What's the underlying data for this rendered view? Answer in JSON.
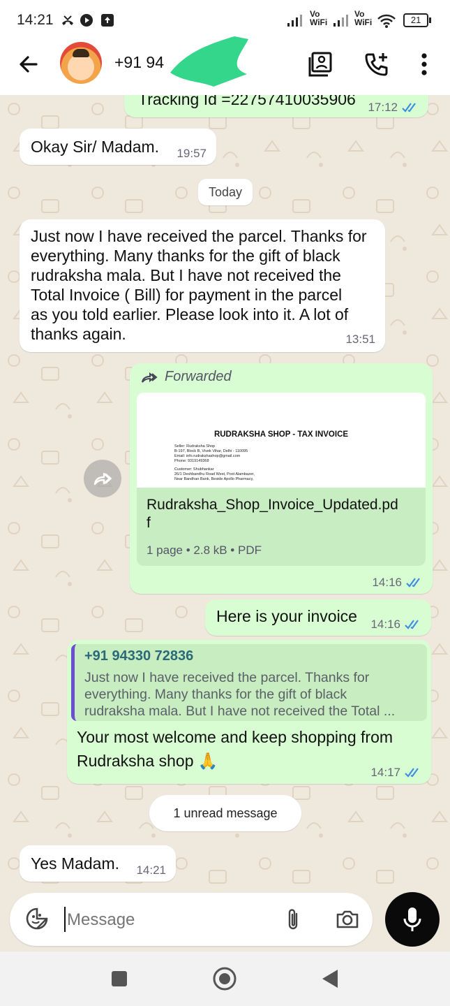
{
  "status": {
    "time": "14:21",
    "net1": "Vo WiFi",
    "net2": "Vo WiFi",
    "battery": "21"
  },
  "header": {
    "contact": "+91 94"
  },
  "messages": {
    "tracking": {
      "text": "Tracking Id =22757410035906",
      "time": "17:12"
    },
    "okay": {
      "text": "Okay Sir/ Madam.",
      "time": "19:57"
    },
    "today": "Today",
    "received": {
      "lines": [
        "Just now I have received the parcel. Thanks for",
        "everything. Many thanks for the gift of black",
        "rudraksha mala. But I have not received the",
        "Total Invoice ( Bill) for payment in the parcel",
        "as you told earlier. Please look into it. A lot of",
        "thanks again."
      ],
      "time": "13:51"
    },
    "forward": {
      "label": "Forwarded",
      "preview_title": "RUDRAKSHA SHOP - TAX INVOICE",
      "preview_lines": [
        "Seller: Rudraksha Shop",
        "B-197, Block B, Vivek Vihar, Delhi - 110095",
        "Email: info.rudrakshashop@gmail.com",
        "Phone: 9319149368",
        "",
        "Customer: Shubhankar",
        "26/1 Deshbandhu Road West, Post Alambazer,",
        "Near Bandhan Bank, Beside Apollo Pharmacy,"
      ],
      "filename_line1": "Rudraksha_Shop_Invoice_Updated.pd",
      "filename_line2": "f",
      "file_meta": "1 page • 2.8 kB • PDF",
      "time": "14:16"
    },
    "invoice": {
      "text": "Here is your invoice",
      "time": "14:16"
    },
    "reply": {
      "quoted_name": "+91 94330 72836",
      "quoted_lines": [
        "Just now I have received the parcel. Thanks for",
        "everything. Many thanks for the gift of black",
        "rudraksha mala. But I have not received the Total ..."
      ],
      "lines": [
        "Your most welcome and keep shopping from",
        "Rudraksha shop 🙏"
      ],
      "time": "14:17"
    },
    "unread": "1 unread message",
    "yes": {
      "text": "Yes Madam.",
      "time": "14:21"
    }
  },
  "composer": {
    "placeholder": "Message"
  },
  "colors": {
    "incoming": "#ffffff",
    "outgoing": "#d9fdd3",
    "tick_blue": "#3d8fe0",
    "background": "#efe8dd"
  },
  "icons": [
    "missed-call-icon",
    "media-icon",
    "upload-icon",
    "signal-icon",
    "wifi-icon",
    "battery-icon",
    "back-arrow-icon",
    "contacts-icon",
    "add-call-icon",
    "more-icon",
    "forward-icon",
    "sticker-icon",
    "attach-icon",
    "camera-icon",
    "mic-icon",
    "home-icon",
    "back-nav-icon",
    "recents-icon"
  ]
}
